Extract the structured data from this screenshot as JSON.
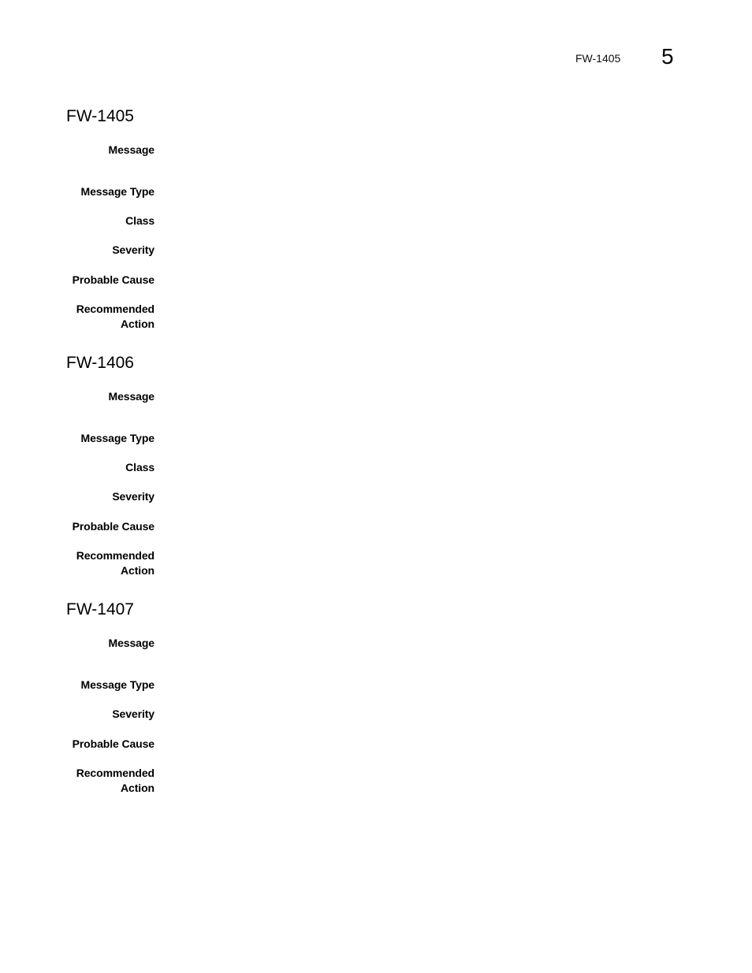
{
  "header": {
    "running_title": "FW-1405",
    "chapter_number": "5"
  },
  "entries": [
    {
      "id": "FW-1405",
      "fields": {
        "message": {
          "label": "Message",
          "value": ""
        },
        "message_type": {
          "label": "Message Type",
          "value": ""
        },
        "class": {
          "label": "Class",
          "value": ""
        },
        "severity": {
          "label": "Severity",
          "value": ""
        },
        "probable_cause": {
          "label": "Probable Cause",
          "value": ""
        },
        "recommended_action": {
          "label_line1": "Recommended",
          "label_line2": "Action",
          "value": ""
        }
      }
    },
    {
      "id": "FW-1406",
      "fields": {
        "message": {
          "label": "Message",
          "value": ""
        },
        "message_type": {
          "label": "Message Type",
          "value": ""
        },
        "class": {
          "label": "Class",
          "value": ""
        },
        "severity": {
          "label": "Severity",
          "value": ""
        },
        "probable_cause": {
          "label": "Probable Cause",
          "value": ""
        },
        "recommended_action": {
          "label_line1": "Recommended",
          "label_line2": "Action",
          "value": ""
        }
      }
    },
    {
      "id": "FW-1407",
      "fields": {
        "message": {
          "label": "Message",
          "value": ""
        },
        "message_type": {
          "label": "Message Type",
          "value": ""
        },
        "severity": {
          "label": "Severity",
          "value": ""
        },
        "probable_cause": {
          "label": "Probable Cause",
          "value": ""
        },
        "recommended_action": {
          "label_line1": "Recommended",
          "label_line2": "Action",
          "value": ""
        }
      }
    }
  ]
}
